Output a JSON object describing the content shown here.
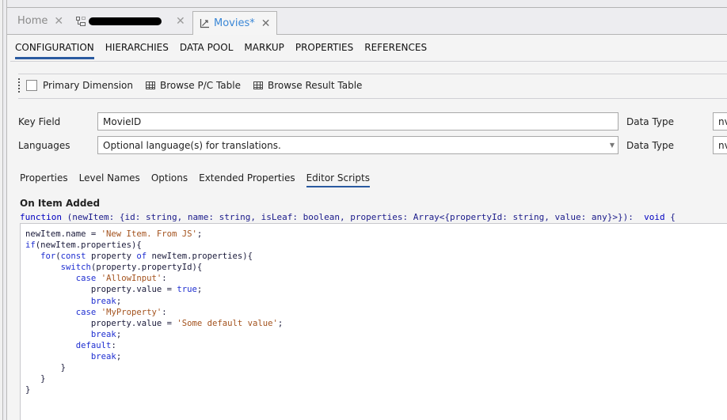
{
  "tabs": [
    {
      "label": "Home",
      "icon": "none",
      "active": false
    },
    {
      "label": "[redacted]",
      "icon": "hierarchy-icon",
      "active": false,
      "redacted": true
    },
    {
      "label": "Movies*",
      "icon": "chart-axis-icon",
      "active": true
    }
  ],
  "close_glyph": "✕",
  "subnav": [
    "CONFIGURATION",
    "HIERARCHIES",
    "DATA POOL",
    "MARKUP",
    "PROPERTIES",
    "REFERENCES"
  ],
  "subnav_active": "CONFIGURATION",
  "toolbar": {
    "primary_dimension": "Primary Dimension",
    "primary_dimension_checked": false,
    "browse_pc": "Browse P/C Table",
    "browse_result": "Browse Result Table"
  },
  "form": {
    "key_field_label": "Key Field",
    "key_field_value": "MovieID",
    "languages_label": "Languages",
    "languages_placeholder": "Optional language(s) for translations.",
    "data_type_label": "Data Type",
    "data_type_value_1": "nv",
    "data_type_value_2": "nv"
  },
  "subtabs": [
    "Properties",
    "Level Names",
    "Options",
    "Extended Properties",
    "Editor Scripts"
  ],
  "subtab_active": "Editor Scripts",
  "script": {
    "title": "On Item Added",
    "signature_kw": "function",
    "signature": " (newItem: {id: string, name: string, isLeaf: boolean, properties: Array<{propertyId: string, value: any}>}):  ",
    "signature_ret": "void",
    "signature_end": " {",
    "code_lines": [
      [
        {
          "t": "newItem.name = "
        },
        {
          "s": "'New Item. From JS'"
        },
        {
          "t": ";"
        }
      ],
      [
        {
          "k": "if"
        },
        {
          "t": "(newItem.properties){"
        }
      ],
      [
        {
          "t": "   "
        },
        {
          "k": "for"
        },
        {
          "t": "("
        },
        {
          "k": "const"
        },
        {
          "t": " property "
        },
        {
          "k": "of"
        },
        {
          "t": " newItem.properties){"
        }
      ],
      [
        {
          "t": "       "
        },
        {
          "k": "switch"
        },
        {
          "t": "(property.propertyId){"
        }
      ],
      [
        {
          "t": "          "
        },
        {
          "k": "case"
        },
        {
          "t": " "
        },
        {
          "s": "'AllowInput'"
        },
        {
          "t": ":"
        }
      ],
      [
        {
          "t": "             property.value = "
        },
        {
          "k": "true"
        },
        {
          "t": ";"
        }
      ],
      [
        {
          "t": "             "
        },
        {
          "k": "break"
        },
        {
          "t": ";"
        }
      ],
      [
        {
          "t": "          "
        },
        {
          "k": "case"
        },
        {
          "t": " "
        },
        {
          "s": "'MyProperty'"
        },
        {
          "t": ":"
        }
      ],
      [
        {
          "t": "             property.value = "
        },
        {
          "s": "'Some default value'"
        },
        {
          "t": ";"
        }
      ],
      [
        {
          "t": "             "
        },
        {
          "k": "break"
        },
        {
          "t": ";"
        }
      ],
      [
        {
          "t": "          "
        },
        {
          "k": "default"
        },
        {
          "t": ":"
        }
      ],
      [
        {
          "t": "             "
        },
        {
          "k": "break"
        },
        {
          "t": ";"
        }
      ],
      [
        {
          "t": "       }"
        }
      ],
      [
        {
          "t": "   }"
        }
      ],
      [
        {
          "t": "}"
        }
      ]
    ]
  }
}
